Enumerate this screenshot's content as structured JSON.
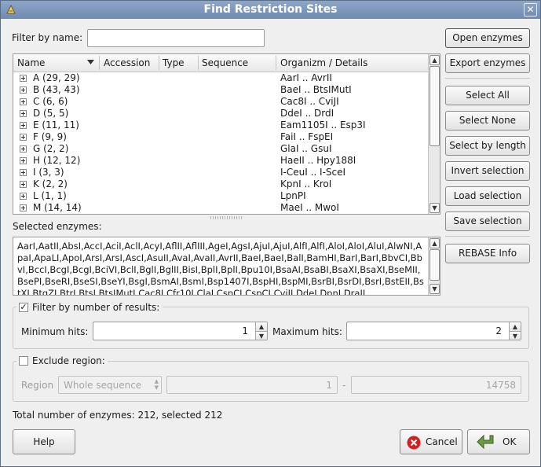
{
  "window": {
    "title": "Find Restriction Sites"
  },
  "filter": {
    "label": "Filter by name:",
    "value": ""
  },
  "tree": {
    "columns": [
      "Name",
      "Accession",
      "Type",
      "Sequence",
      "Organizm / Details"
    ],
    "rows": [
      {
        "name": "A (29, 29)",
        "details": "AarI .. AvrII"
      },
      {
        "name": "B (43, 43)",
        "details": "BaeI .. BtsIMutI"
      },
      {
        "name": "C (6, 6)",
        "details": "Cac8I .. CviJI"
      },
      {
        "name": "D (5, 5)",
        "details": "DdeI .. DrdI"
      },
      {
        "name": "E (11, 11)",
        "details": "Eam1105I .. Esp3I"
      },
      {
        "name": "F (9, 9)",
        "details": "FaiI .. FspEI"
      },
      {
        "name": "G (2, 2)",
        "details": "GlaI .. GsuI"
      },
      {
        "name": "H (12, 12)",
        "details": "HaeII .. Hpy188I"
      },
      {
        "name": "I (3, 3)",
        "details": "I-CeuI .. I-SceI"
      },
      {
        "name": "K (2, 2)",
        "details": "KpnI .. KroI"
      },
      {
        "name": "L (1, 1)",
        "details": "LpnPI"
      },
      {
        "name": "M (14, 14)",
        "details": "MaeI .. MwoI"
      }
    ]
  },
  "selected": {
    "label": "Selected enzymes:",
    "text": "AarI,AatII,AbsI,AccI,AciI,AclI,AcyI,AflII,AflIII,AgeI,AgsI,AjuI,AjuI,AlfI,AlfI,AloI,AloI,AluI,AlwNI,ApaI,ApaLI,ApoI,ArsI,ArsI,AscI,AsuII,AvaI,AvaII,AvrII,BaeI,BaeI,BalI,BamHI,BarI,BarI,BbvCI,BbvI,BccI,BcgI,BcgI,BciVI,BclI,BglI,BglII,BisI,BplI,BplI,Bpu10I,BsaAI,BsaBI,BsaXI,BsaXI,BseMII,BsePI,BseRI,BseSI,BseYI,BsgI,BsmAI,BsmI,Bsp1407I,BspHI,BspMI,BsrBI,BsrDI,BsrI,BstEII,BstXI,BtgZI,BtrI,BtsI,BtsIMutI,Cac8I,Cfr10I,ClaI,CspCI,CspCI,CviJI,DdeI,DpnI,DraII"
  },
  "filter_results": {
    "label": "Filter by number of results:",
    "checked": true,
    "min_label": "Minimum hits:",
    "min_value": "1",
    "max_label": "Maximum hits:",
    "max_value": "2"
  },
  "exclude": {
    "label": "Exclude region:",
    "checked": false,
    "region_label": "Region",
    "region_value": "Whole sequence",
    "from": "1",
    "dash": "-",
    "to": "14758"
  },
  "total": "Total number of enzymes: 212, selected 212",
  "buttons": {
    "open": "Open enzymes",
    "export": "Export enzymes",
    "select_all": "Select All",
    "select_none": "Select None",
    "select_by_length": "Select by length",
    "invert": "Invert selection",
    "load": "Load selection",
    "save": "Save selection",
    "rebase": "REBASE Info",
    "help": "Help",
    "cancel": "Cancel",
    "ok": "OK"
  },
  "colors": {
    "title_bar": "#7f98bc",
    "cancel_icon": "#d42020",
    "ok_icon": "#5c8a3a"
  }
}
